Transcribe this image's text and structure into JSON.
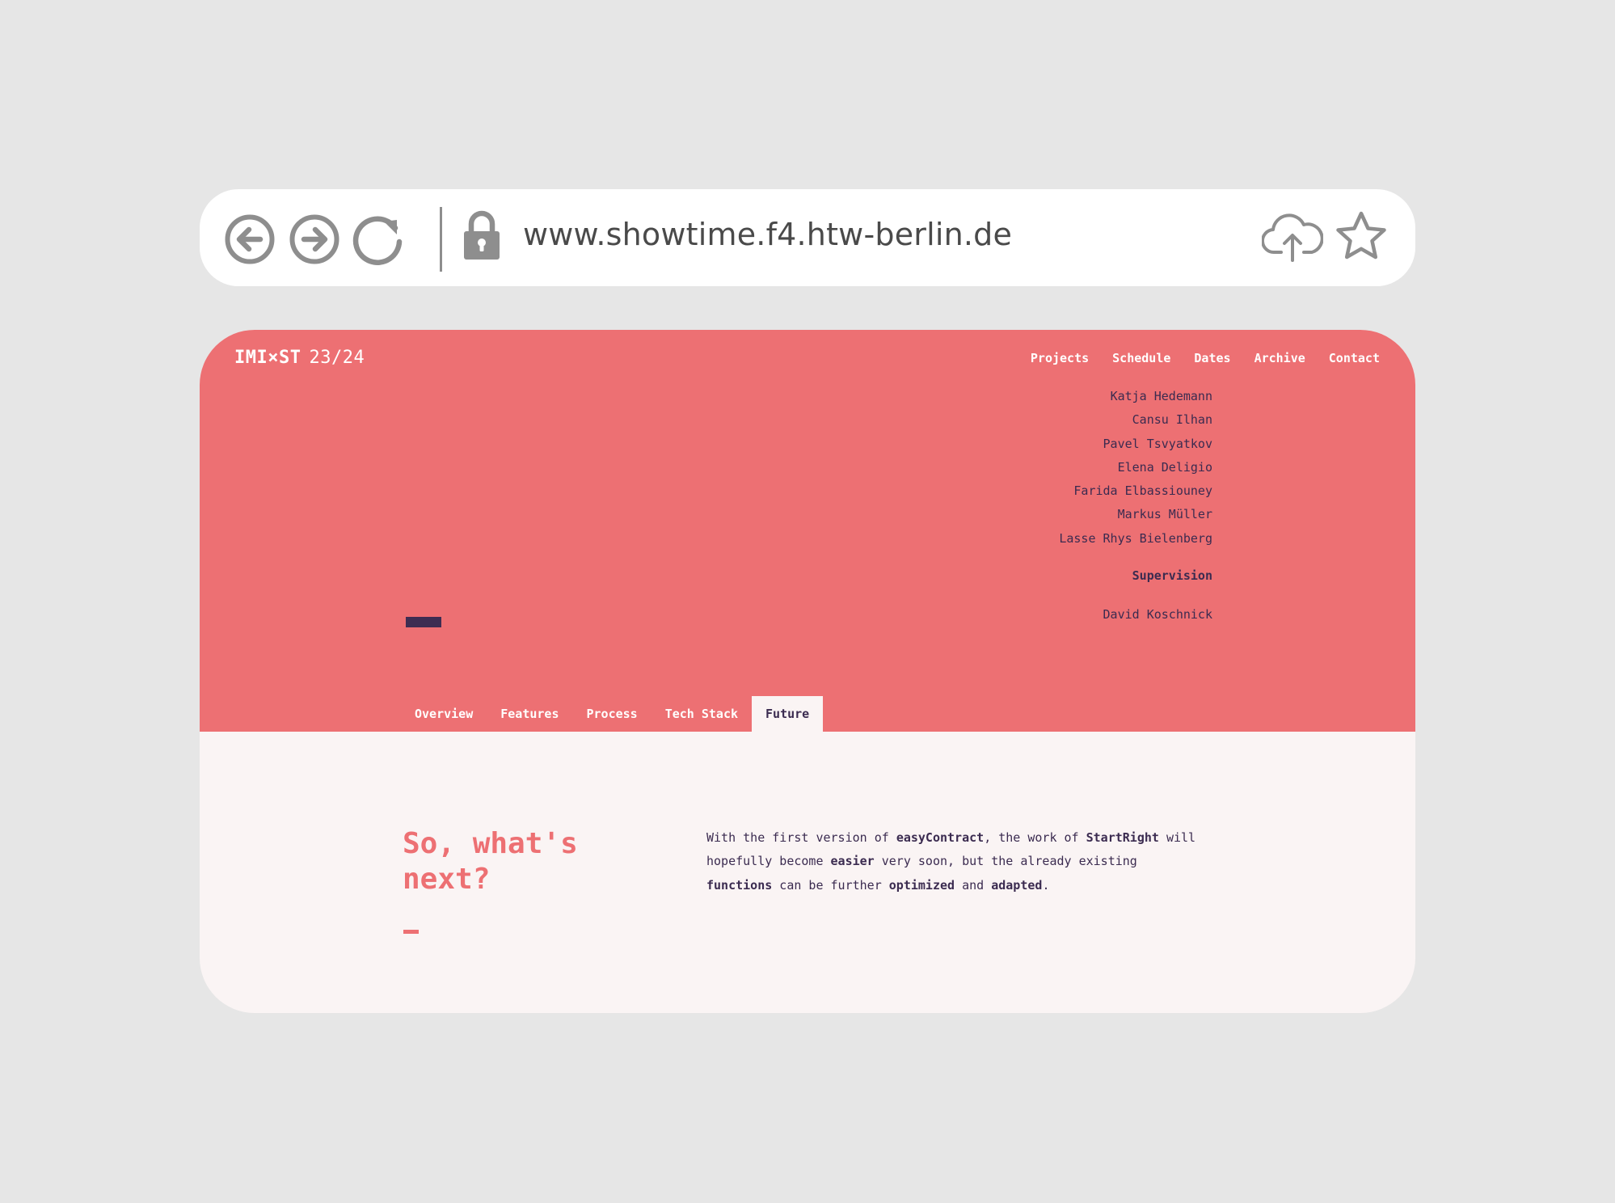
{
  "browser": {
    "url": "www.showtime.f4.htw-berlin.de"
  },
  "site": {
    "logo_mark": "IMI×ST",
    "logo_year": "23/24",
    "nav": [
      {
        "label": "Projects"
      },
      {
        "label": "Schedule"
      },
      {
        "label": "Dates"
      },
      {
        "label": "Archive"
      },
      {
        "label": "Contact"
      }
    ]
  },
  "team": {
    "members": [
      "Katja Hedemann",
      "Cansu Ilhan",
      "Pavel Tsvyatkov",
      "Elena Deligio",
      "Farida Elbassiouney",
      "Markus Müller",
      "Lasse Rhys Bielenberg"
    ],
    "supervision_label": "Supervision",
    "supervisor": "David Koschnick"
  },
  "tabs": [
    {
      "label": "Overview",
      "active": false
    },
    {
      "label": "Features",
      "active": false
    },
    {
      "label": "Process",
      "active": false
    },
    {
      "label": "Tech Stack",
      "active": false
    },
    {
      "label": "Future",
      "active": true
    }
  ],
  "section": {
    "title_line1": "So, what's",
    "title_line2": "next?",
    "p1": "With the first version of ",
    "b1": "easyContract",
    "p2": ", the work of ",
    "b2": "StartRight",
    "p3": " will hopefully become ",
    "b3": "easier",
    "p4": " very soon, but the already existing ",
    "b4": "functions",
    "p5": " can be further ",
    "b5": "optimized",
    "p6": " and ",
    "b6": "adapted",
    "p7": "."
  },
  "colors": {
    "background": "#e6e6e6",
    "accent": "#ed7073",
    "dark": "#3b2b50",
    "content_bg": "#faf4f4",
    "icon_gray": "#8e8e8e"
  },
  "icons": {
    "back": "arrow-left-circle-icon",
    "forward": "arrow-right-circle-icon",
    "reload": "reload-icon",
    "lock": "lock-icon",
    "upload": "cloud-upload-icon",
    "bookmark": "star-icon"
  }
}
